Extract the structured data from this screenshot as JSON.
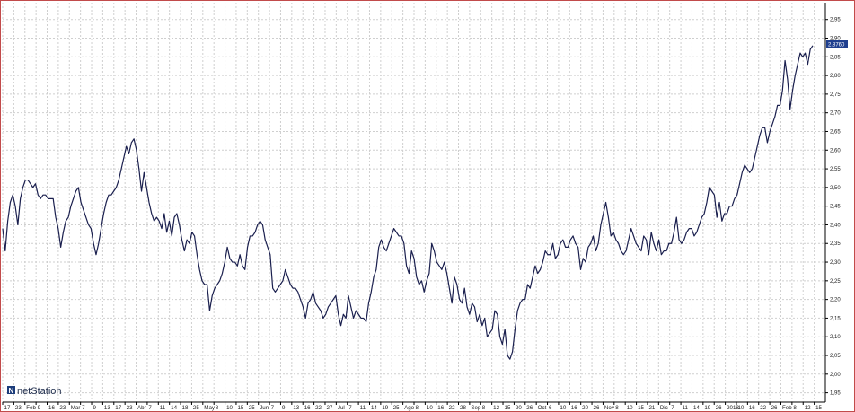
{
  "brand": {
    "name": "netStation",
    "logo_letter": "N"
  },
  "last_value_label": "2.8760",
  "chart_data": {
    "type": "line",
    "title": "",
    "xlabel": "",
    "ylabel": "",
    "ylim": [
      1.925,
      2.995
    ],
    "y_ticks": [
      "1,95",
      "2,00",
      "2,05",
      "2,10",
      "2,15",
      "2,20",
      "2,25",
      "2,30",
      "2,35",
      "2,40",
      "2,45",
      "2,50",
      "2,55",
      "2,60",
      "2,65",
      "2,70",
      "2,75",
      "2,80",
      "2,85",
      "2,90",
      "2,95"
    ],
    "x_tick_labels": [
      "17",
      "23",
      "Feb",
      "9",
      "16",
      "23",
      "Mar",
      "7",
      "9",
      "13",
      "17",
      "23",
      "Abr",
      "7",
      "11",
      "14",
      "18",
      "25",
      "May",
      "8",
      "10",
      "15",
      "25",
      "Jun",
      "7",
      "9",
      "13",
      "16",
      "22",
      "27",
      "Jul",
      "7",
      "11",
      "14",
      "19",
      "25",
      "Ago",
      "8",
      "10",
      "16",
      "22",
      "28",
      "Sep",
      "8",
      "12",
      "15",
      "20",
      "26",
      "Oct",
      "6",
      "10",
      "16",
      "20",
      "26",
      "Nov",
      "8",
      "10",
      "15",
      "21",
      "Dic",
      "7",
      "11",
      "14",
      "19",
      "26",
      "2018",
      "10",
      "16",
      "22",
      "26",
      "Feb",
      "8",
      "12",
      "15"
    ],
    "series": [
      {
        "values": [
          2.39,
          2.33,
          2.41,
          2.46,
          2.48,
          2.45,
          2.4,
          2.47,
          2.5,
          2.52,
          2.52,
          2.51,
          2.5,
          2.51,
          2.48,
          2.47,
          2.48,
          2.48,
          2.47,
          2.47,
          2.47,
          2.42,
          2.39,
          2.34,
          2.38,
          2.41,
          2.42,
          2.45,
          2.47,
          2.49,
          2.5,
          2.46,
          2.44,
          2.42,
          2.4,
          2.39,
          2.35,
          2.32,
          2.35,
          2.39,
          2.43,
          2.46,
          2.48,
          2.48,
          2.49,
          2.5,
          2.52,
          2.55,
          2.58,
          2.61,
          2.59,
          2.62,
          2.63,
          2.6,
          2.55,
          2.49,
          2.54,
          2.5,
          2.46,
          2.43,
          2.41,
          2.42,
          2.41,
          2.39,
          2.43,
          2.38,
          2.41,
          2.37,
          2.42,
          2.43,
          2.4,
          2.36,
          2.33,
          2.36,
          2.35,
          2.38,
          2.37,
          2.32,
          2.28,
          2.25,
          2.24,
          2.24,
          2.17,
          2.21,
          2.23,
          2.24,
          2.25,
          2.27,
          2.3,
          2.34,
          2.31,
          2.3,
          2.3,
          2.29,
          2.32,
          2.29,
          2.28,
          2.34,
          2.37,
          2.37,
          2.38,
          2.4,
          2.41,
          2.4,
          2.36,
          2.34,
          2.32,
          2.23,
          2.22,
          2.23,
          2.24,
          2.25,
          2.28,
          2.26,
          2.24,
          2.23,
          2.23,
          2.22,
          2.2,
          2.18,
          2.15,
          2.19,
          2.2,
          2.22,
          2.19,
          2.18,
          2.17,
          2.15,
          2.16,
          2.18,
          2.19,
          2.2,
          2.21,
          2.16,
          2.13,
          2.16,
          2.15,
          2.21,
          2.18,
          2.15,
          2.17,
          2.16,
          2.15,
          2.15,
          2.14,
          2.19,
          2.22,
          2.26,
          2.28,
          2.34,
          2.36,
          2.34,
          2.33,
          2.35,
          2.37,
          2.39,
          2.38,
          2.37,
          2.37,
          2.35,
          2.29,
          2.27,
          2.33,
          2.31,
          2.26,
          2.24,
          2.25,
          2.22,
          2.25,
          2.27,
          2.35,
          2.33,
          2.3,
          2.29,
          2.28,
          2.3,
          2.27,
          2.23,
          2.19,
          2.26,
          2.24,
          2.2,
          2.19,
          2.23,
          2.18,
          2.16,
          2.19,
          2.18,
          2.14,
          2.16,
          2.13,
          2.15,
          2.1,
          2.11,
          2.12,
          2.17,
          2.16,
          2.1,
          2.08,
          2.12,
          2.05,
          2.04,
          2.06,
          2.12,
          2.17,
          2.19,
          2.2,
          2.2,
          2.24,
          2.23,
          2.26,
          2.29,
          2.27,
          2.28,
          2.3,
          2.33,
          2.32,
          2.32,
          2.35,
          2.31,
          2.32,
          2.35,
          2.36,
          2.34,
          2.34,
          2.36,
          2.37,
          2.35,
          2.34,
          2.28,
          2.31,
          2.3,
          2.34,
          2.35,
          2.37,
          2.33,
          2.35,
          2.4,
          2.43,
          2.46,
          2.42,
          2.37,
          2.38,
          2.36,
          2.35,
          2.33,
          2.32,
          2.33,
          2.36,
          2.39,
          2.37,
          2.35,
          2.34,
          2.33,
          2.37,
          2.36,
          2.32,
          2.38,
          2.35,
          2.33,
          2.36,
          2.32,
          2.33,
          2.33,
          2.35,
          2.35,
          2.38,
          2.42,
          2.36,
          2.35,
          2.36,
          2.38,
          2.39,
          2.39,
          2.37,
          2.38,
          2.4,
          2.42,
          2.43,
          2.46,
          2.5,
          2.49,
          2.48,
          2.42,
          2.46,
          2.41,
          2.43,
          2.43,
          2.45,
          2.45,
          2.47,
          2.48,
          2.51,
          2.54,
          2.56,
          2.55,
          2.54,
          2.55,
          2.58,
          2.61,
          2.64,
          2.66,
          2.66,
          2.62,
          2.65,
          2.67,
          2.69,
          2.72,
          2.72,
          2.76,
          2.84,
          2.79,
          2.71,
          2.76,
          2.8,
          2.83,
          2.86,
          2.85,
          2.86,
          2.83,
          2.87,
          2.88
        ]
      }
    ]
  }
}
